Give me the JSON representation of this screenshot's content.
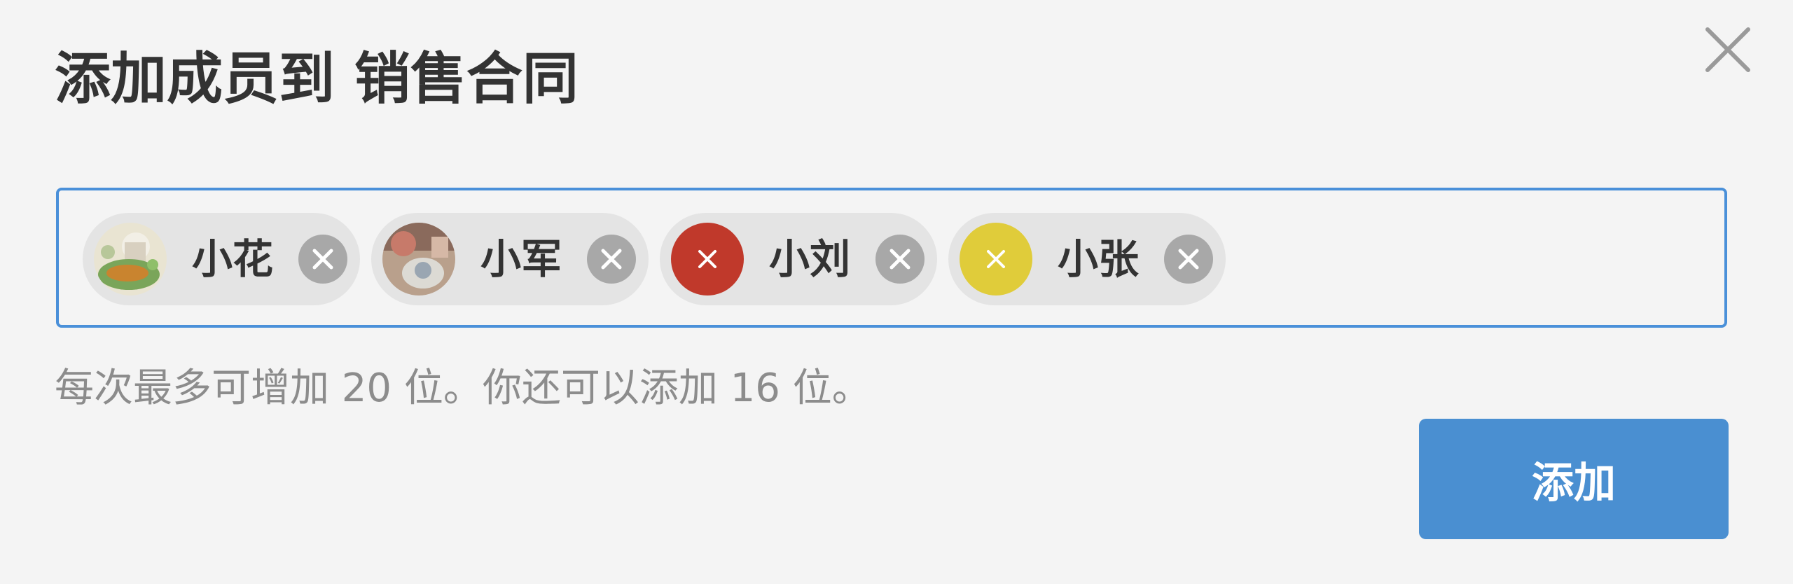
{
  "dialog": {
    "title": "添加成员到 销售合同",
    "close_icon": "close-icon"
  },
  "members": [
    {
      "name": "小花",
      "avatar": "photo-avatar-food",
      "remove_icon": "remove-circle-icon"
    },
    {
      "name": "小军",
      "avatar": "photo-avatar-items",
      "remove_icon": "remove-circle-icon"
    },
    {
      "name": "小刘",
      "avatar": "letter-avatar-x",
      "avatar_color": "#c0392b",
      "remove_icon": "remove-circle-icon"
    },
    {
      "name": "小张",
      "avatar": "letter-avatar-x",
      "avatar_color": "#e0cc3a",
      "remove_icon": "remove-circle-icon"
    }
  ],
  "hint": "每次最多可增加 20 位。你还可以添加 16 位。",
  "add_button": "添加",
  "colors": {
    "accent": "#4a8fd1",
    "input_border": "#4a90d9",
    "background": "#f4f4f4",
    "chip_background": "#e4e4e4",
    "remove_icon": "#a8a8a8"
  }
}
